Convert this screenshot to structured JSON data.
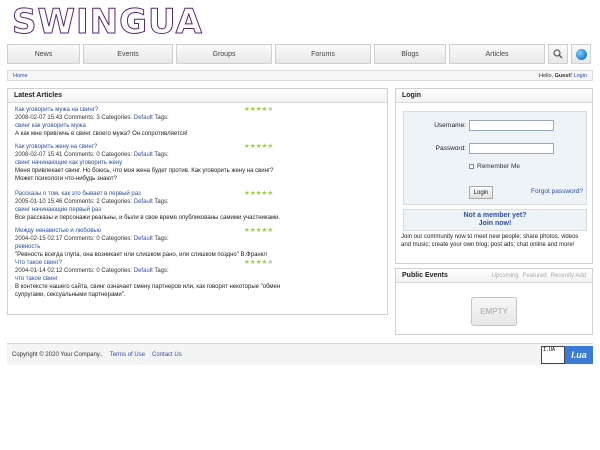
{
  "logo": {
    "text": "SWINGUA"
  },
  "nav": {
    "items": [
      "News",
      "Events",
      "Groups",
      "Forums",
      "Blogs",
      "Articles"
    ],
    "search_icon": "search-icon",
    "globe_icon": "globe-icon"
  },
  "breadcrumb": {
    "home": "Home",
    "hello": "Hello,",
    "guest": "Guest!",
    "login": "Login"
  },
  "latest": {
    "heading": "Latest Articles",
    "articles": [
      {
        "title": "Как уговорить мужа на свинг?",
        "date": "2008-02-07 15:43",
        "comments": "Comments: 3",
        "categories_label": "Categories:",
        "category": "Default",
        "tags_label": "Tags:",
        "tags": "свинг  как уговорить мужа",
        "body": "А как мне привлечь в свинг своего мужа? Он сопротивляется!",
        "rating": 4
      },
      {
        "title": "Как уговорить жену на свинг?",
        "date": "2008-02-07 15:41",
        "comments": "Comments: 0",
        "categories_label": "Categories:",
        "category": "Default",
        "tags_label": "Tags:",
        "tags": "свинг  начинающие  как уговорить жену",
        "body": "Меня привлекает свинг. Но боюсь, что моя жена будет против. Как уговорить жену на свинг? Может психологи что-нибудь знают?",
        "rating": 5
      },
      {
        "title": "Рассказы о том, как это бывает в первый раз",
        "date": "2005-01-10 15:46",
        "comments": "Comments: 2",
        "categories_label": "Categories:",
        "category": "Default",
        "tags_label": "Tags:",
        "tags": "свинг  начинающие  первый раз",
        "body": "Все рассказы и персонажи реальны, и были в свое время опубликованы самими участниками.",
        "rating": 5
      },
      {
        "title": "Между ненавистью и любовью",
        "date": "2004-02-15 02:17",
        "comments": "Comments: 0",
        "categories_label": "Categories:",
        "category": "Default",
        "tags_label": "Tags:",
        "tags": "ревность",
        "body": "\"Ревность всегда глупа, она возникает или слишком рано, или слишком поздно\" В.Франкл",
        "rating": 5
      },
      {
        "title": "Что такое свинг?",
        "date": "2004-01-14 02:12",
        "comments": "Comments: 0",
        "categories_label": "Categories:",
        "category": "Default",
        "tags_label": "Tags:",
        "tags": "что такое свинг",
        "body": "В контексте нашего сайта, свинг означает смену партнеров или, как говорят некоторые \"обмен супругами, сексуальными партнерами\".",
        "rating": 4
      }
    ]
  },
  "login": {
    "heading": "Login",
    "username_label": "Username:",
    "password_label": "Password:",
    "remember_label": "Remember Me",
    "login_button": "Login",
    "forgot": "Forgot password?",
    "not_member": "Not a member yet?",
    "join_now": "Join now!",
    "join_text": "Join our community now to meet new people; share photos, videos and music; create your own blog; post ads; chat online and more!"
  },
  "events": {
    "heading": "Public Events",
    "tabs": [
      "Upcoming",
      "Featured",
      "Recently Add"
    ],
    "empty": "EMPTY"
  },
  "footer": {
    "copyright": "Copyright © 2020 Your Company..",
    "terms": "Terms of Use",
    "contact": "Contact Us"
  },
  "badge": {
    "left": "I.UA",
    "right": "I.ua"
  },
  "colors": {
    "link": "#2c4fa8",
    "star_on": "#9ad13a",
    "star_off": "#bbbbbb",
    "logo": "#7d3f9e"
  }
}
